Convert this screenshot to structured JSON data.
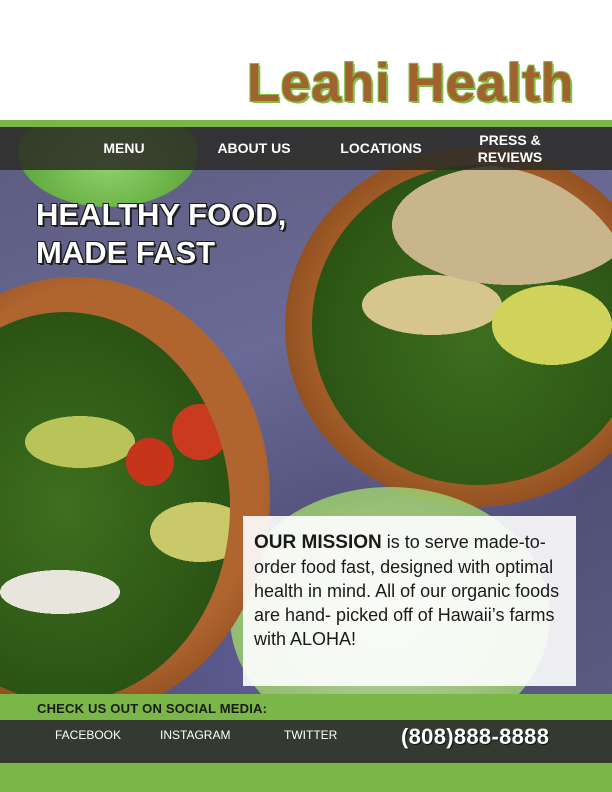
{
  "brand": {
    "name": "Leahi Health"
  },
  "nav": {
    "items": [
      {
        "label": "MENU"
      },
      {
        "label": "ABOUT US"
      },
      {
        "label": "LOCATIONS"
      },
      {
        "label_line1": "PRESS &",
        "label_line2": "REVIEWS"
      }
    ]
  },
  "hero": {
    "headline_line1": "HEALTHY FOOD,",
    "headline_line2": "MADE FAST"
  },
  "mission": {
    "lead": "OUR MISSION",
    "text": " is to serve made-to-order food fast, designed with optimal health in mind. All of our organic foods are hand- picked off of Hawaii’s farms with ALOHA!"
  },
  "footer": {
    "social_title": "CHECK US OUT ON SOCIAL MEDIA:",
    "links": [
      {
        "label": "FACEBOOK"
      },
      {
        "label": "INSTAGRAM"
      },
      {
        "label": "TWITTER"
      }
    ],
    "phone": "(808)888-8888"
  },
  "colors": {
    "accent_green": "#7ab648",
    "brand_brown": "#a0622e",
    "nav_dark": "#2c2c28",
    "footer_dark": "#353a30"
  }
}
